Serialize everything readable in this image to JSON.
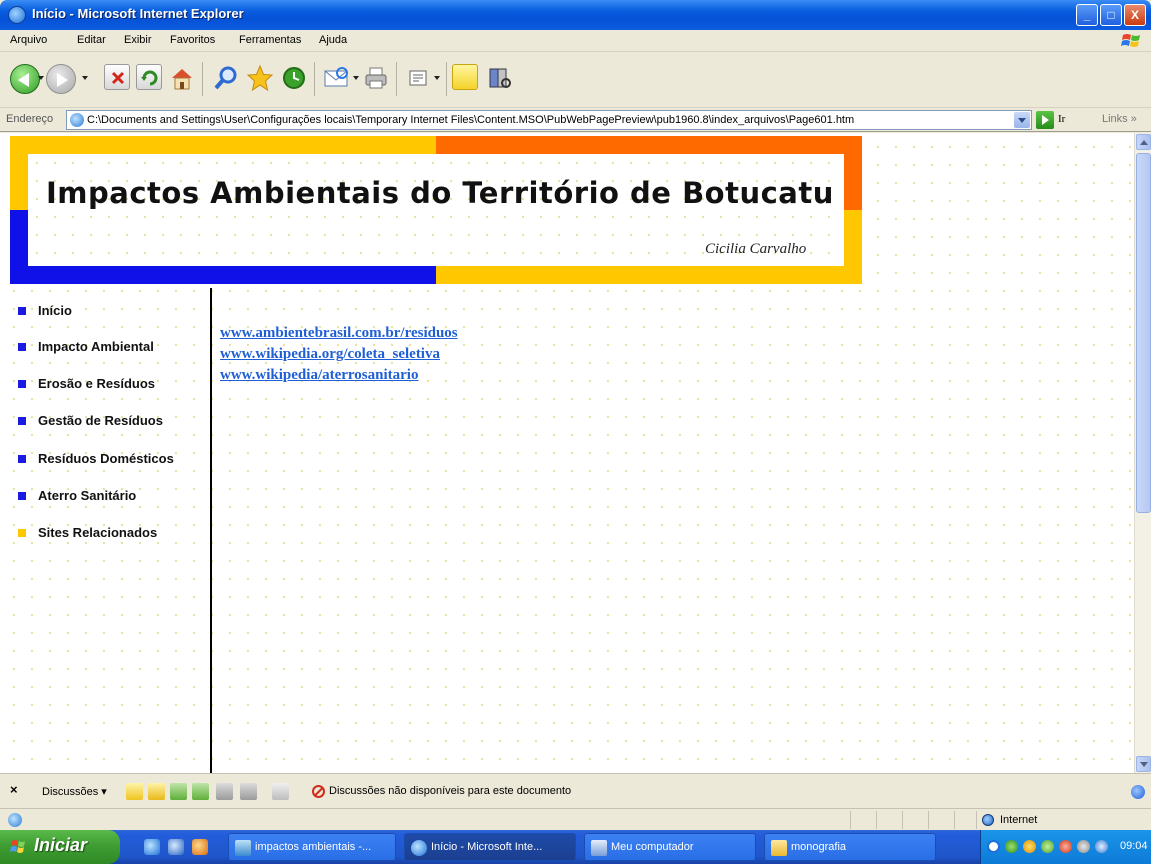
{
  "window": {
    "title": "Início - Microsoft Internet Explorer",
    "buttons": {
      "minimize": "_",
      "maximize": "□",
      "close": "X"
    }
  },
  "menu": [
    "Arquivo",
    "Editar",
    "Exibir",
    "Favoritos",
    "Ferramentas",
    "Ajuda"
  ],
  "address": {
    "label": "Endereço",
    "value": "C:\\Documents and Settings\\User\\Configurações locais\\Temporary Internet Files\\Content.MSO\\PubWebPagePreview\\pub1960.8\\index_arquivos\\Page601.htm",
    "go_label": "Ir",
    "links_label": "Links »"
  },
  "page": {
    "title": "Impactos Ambientais do Território de Botucatu",
    "author": "Cicilia Carvalho",
    "colors": {
      "gold": "#ffc700",
      "orange": "#ff6a00",
      "blue": "#1010e8",
      "link": "#1f5fd6"
    },
    "nav": [
      {
        "label": "Início",
        "bullet": "#1a1ae0"
      },
      {
        "label": "Impacto Ambiental",
        "bullet": "#1a1ae0"
      },
      {
        "label": "Erosão e Resíduos",
        "bullet": "#1a1ae0"
      },
      {
        "label": "Gestão de Resíduos",
        "bullet": "#1a1ae0"
      },
      {
        "label": "Resíduos Domésticos",
        "bullet": "#1a1ae0"
      },
      {
        "label": "Aterro Sanitário",
        "bullet": "#1a1ae0"
      },
      {
        "label": "Sites Relacionados",
        "bullet": "#ffc700"
      }
    ],
    "links": [
      "www.ambientebrasil.com.br/residuos",
      "www.wikipedia.org/coleta_seletiva",
      "www.wikipedia/aterrosanitario"
    ]
  },
  "discussions": {
    "close": "×",
    "label": "Discussões ▾",
    "status": "Discussões não disponíveis para este documento"
  },
  "statusbar": {
    "zone": "Internet"
  },
  "taskbar": {
    "start": "Iniciar",
    "tasks": [
      {
        "label": "impactos ambientais -...",
        "active": false
      },
      {
        "label": "Início - Microsoft Inte...",
        "active": true
      },
      {
        "label": "Meu computador",
        "active": false
      },
      {
        "label": "monografia",
        "active": false
      }
    ],
    "clock": "09:04"
  }
}
